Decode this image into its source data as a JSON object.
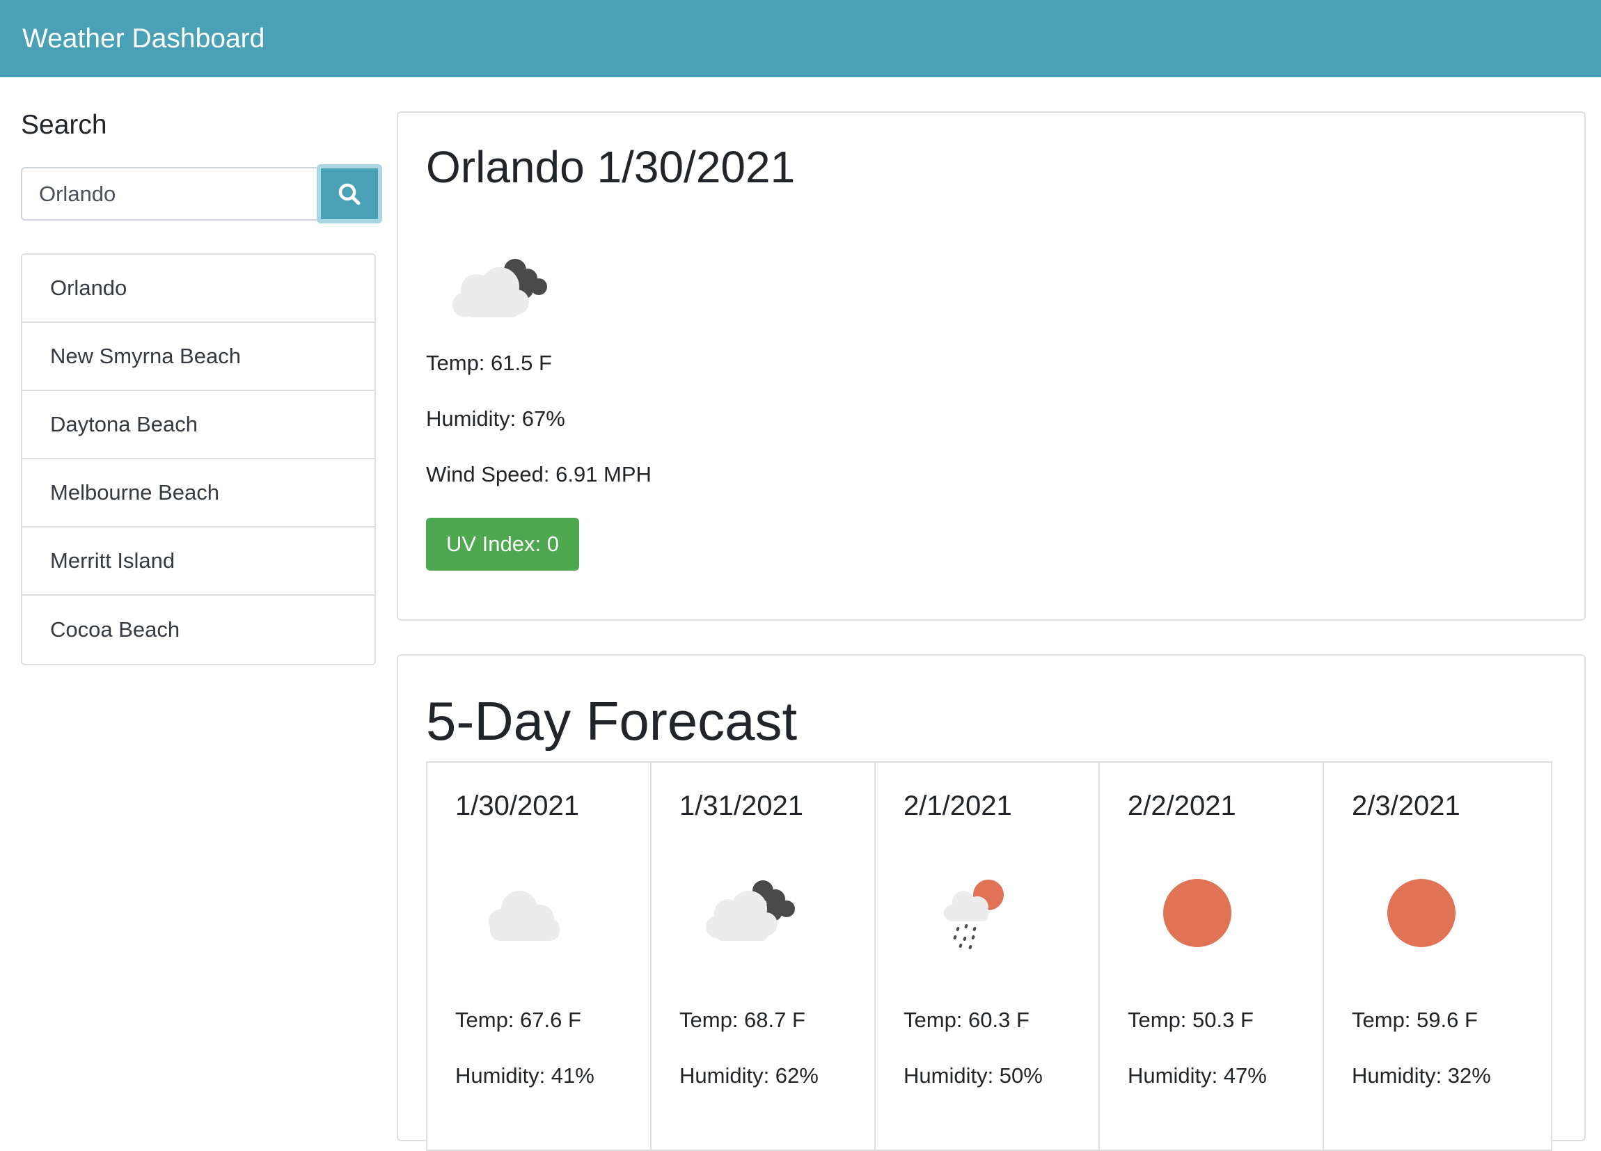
{
  "navbar": {
    "title": "Weather Dashboard"
  },
  "sidebar": {
    "search_title": "Search",
    "search": {
      "value": "Orlando",
      "button_icon": "search-icon"
    },
    "history": [
      {
        "label": "Orlando"
      },
      {
        "label": "New Smyrna Beach"
      },
      {
        "label": "Daytona Beach"
      },
      {
        "label": "Melbourne Beach"
      },
      {
        "label": "Merritt Island"
      },
      {
        "label": "Cocoa Beach"
      }
    ]
  },
  "current": {
    "title": "Orlando 1/30/2021",
    "icon": "broken-clouds-icon",
    "temp": "Temp: 61.5 F",
    "humidity": "Humidity: 67%",
    "wind": "Wind Speed: 6.91 MPH",
    "uv": "UV Index: 0",
    "uv_color": "#4ea84f"
  },
  "forecast": {
    "title": "5-Day Forecast",
    "days": [
      {
        "date": "1/30/2021",
        "icon": "cloud-icon",
        "temp": "Temp: 67.6 F",
        "humidity": "Humidity: 41%"
      },
      {
        "date": "1/31/2021",
        "icon": "broken-clouds-icon",
        "temp": "Temp: 68.7 F",
        "humidity": "Humidity: 62%"
      },
      {
        "date": "2/1/2021",
        "icon": "rain-sun-icon",
        "temp": "Temp: 60.3 F",
        "humidity": "Humidity: 50%"
      },
      {
        "date": "2/2/2021",
        "icon": "sun-icon",
        "temp": "Temp: 50.3 F",
        "humidity": "Humidity: 47%"
      },
      {
        "date": "2/3/2021",
        "icon": "sun-icon",
        "temp": "Temp: 59.6 F",
        "humidity": "Humidity: 32%"
      }
    ]
  },
  "colors": {
    "navbar": "#4aa1b6",
    "sun": "#e07355",
    "cloud_light": "#ececec",
    "cloud_dark": "#4a4a4a"
  }
}
